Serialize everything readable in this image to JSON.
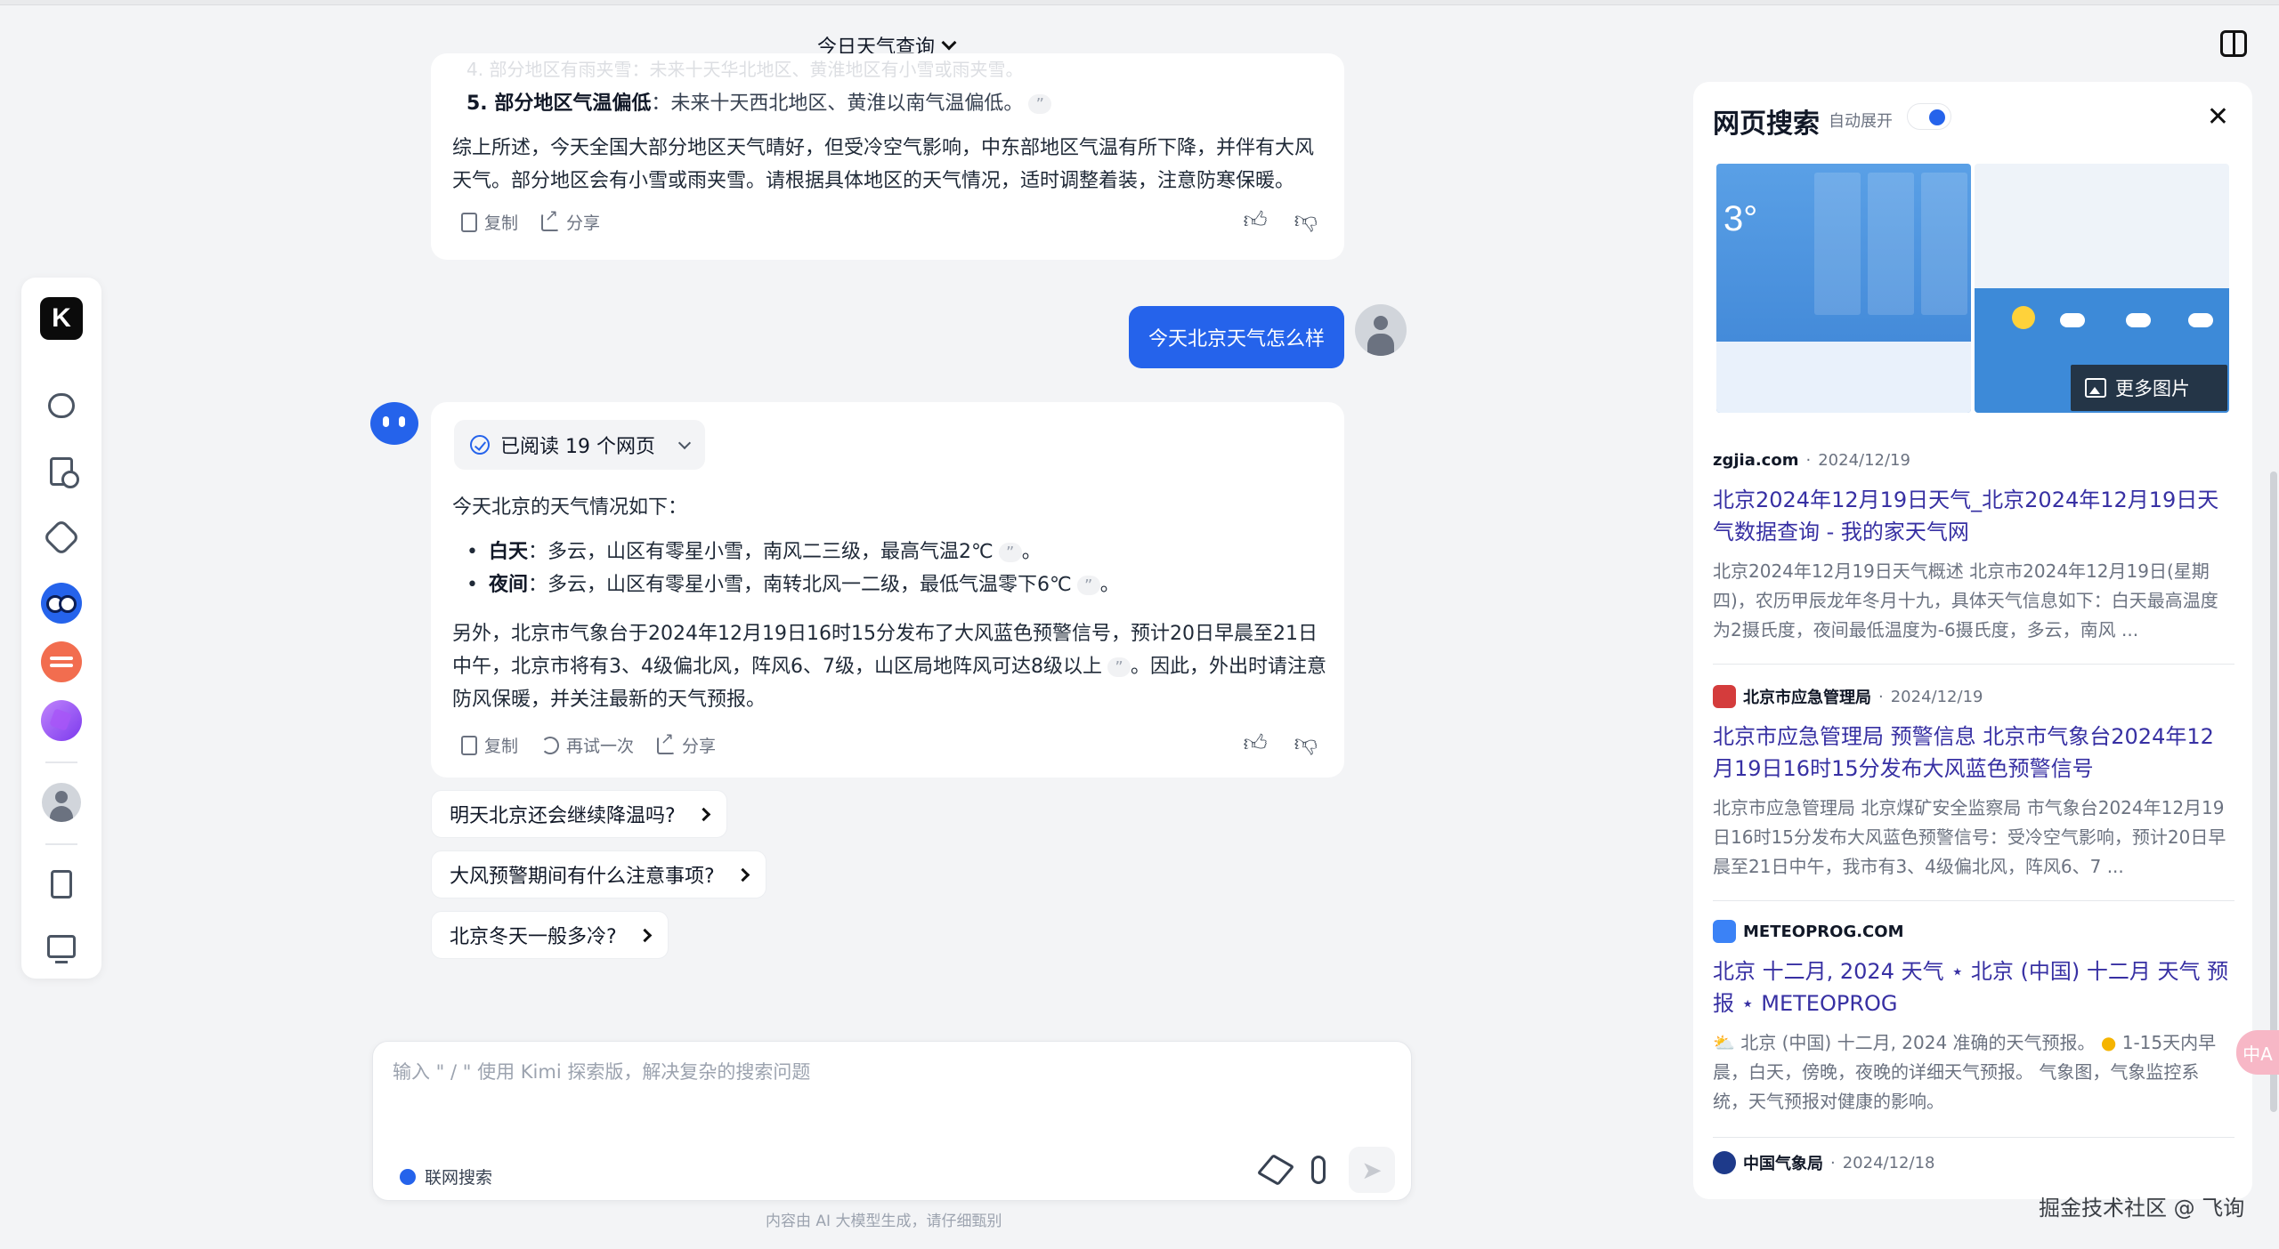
{
  "header": {
    "conversation_title": "今日天气查询"
  },
  "sidebar": {
    "logo_text": "K"
  },
  "previous_answer": {
    "fade_text": "4. 部分地区有雨夹雪：未来十天华北地区、黄淮地区有小雪或雨夹雪。",
    "list_item_label": "5. 部分地区气温偏低",
    "list_item_text": "：未来十天西北地区、黄淮以南气温偏低。",
    "summary": "综上所述，今天全国大部分地区天气晴好，但受冷空气影响，中东部地区气温有所下降，并伴有大风天气。部分地区会有小雪或雨夹雪。请根据具体地区的天气情况，适时调整着装，注意防寒保暖。",
    "actions": {
      "copy": "复制",
      "share": "分享"
    }
  },
  "user_message": "今天北京天气怎么样",
  "answer": {
    "read_pages": "已阅读 19 个网页",
    "intro": "今天北京的天气情况如下：",
    "items": [
      {
        "label": "白天",
        "text": "：多云，山区有零星小雪，南风二三级，最高气温2℃",
        "tail": "。"
      },
      {
        "label": "夜间",
        "text": "：多云，山区有零星小雪，南转北风一二级，最低气温零下6℃",
        "tail": "。"
      }
    ],
    "paragraph_a": "另外，北京市气象台于2024年12月19日16时15分发布了大风蓝色预警信号，预计20日早晨至21日中午，北京市将有3、4级偏北风，阵风6、7级，山区局地阵风可达8级以上",
    "paragraph_b": "。因此，外出时请注意防风保暖，并关注最新的天气预报。",
    "actions": {
      "copy": "复制",
      "retry": "再试一次",
      "share": "分享"
    }
  },
  "suggestions": [
    "明天北京还会继续降温吗?",
    "大风预警期间有什么注意事项?",
    "北京冬天一般多冷?"
  ],
  "input": {
    "placeholder": "输入 \" / \" 使用 Kimi 探索版，解决复杂的搜索问题",
    "web_search_label": "联网搜索"
  },
  "disclaimer": "内容由 AI 大模型生成，请仔细甄别",
  "right_panel": {
    "title": "网页搜索",
    "auto_expand": "自动展开",
    "more_images": "更多图片",
    "results": [
      {
        "source": "zgjia.com",
        "date": "2024/12/19",
        "title": "北京2024年12月19日天气_北京2024年12月19日天气数据查询 - 我的家天气网",
        "snippet": "北京2024年12月19日天气概述 北京市2024年12月19日(星期四)，农历甲辰龙年冬月十九，具体天气信息如下：白天最高温度为2摄氏度，夜间最低温度为-6摄氏度，多云，南风 ...",
        "favicon_color": "#ffffff"
      },
      {
        "source": "北京市应急管理局",
        "date": "2024/12/19",
        "title": "北京市应急管理局 预警信息 北京市气象台2024年12月19日16时15分发布大风蓝色预警信号",
        "snippet": "北京市应急管理局 北京煤矿安全监察局 市气象台2024年12月19日16时15分发布大风蓝色预警信号：受冷空气影响，预计20日早晨至21日中午，我市有3、4级偏北风，阵风6、7 ...",
        "favicon_color": "#d43c3c"
      },
      {
        "source": "METEOPROG.COM",
        "date": "",
        "title": "北京 十二月, 2024 天气 ⋆ 北京 (中国) 十二月 天气 预报 ⋆ METEOPROG",
        "snippet_a": "北京 (中国) 十二月, 2024 准确的天气预报。",
        "snippet_b": "1-15天内早晨，白天，傍晚，夜晚的详细天气预报。 气象图，气象监控系统，天气预报对健康的影响。",
        "favicon_color": "#3b82f6"
      },
      {
        "source": "中国气象局",
        "date": "2024/12/18",
        "favicon_color": "#1e3a8a"
      }
    ],
    "image_a_temp": "3°"
  },
  "float_badge": "中A",
  "watermark": "掘金技术社区 @ 飞询"
}
